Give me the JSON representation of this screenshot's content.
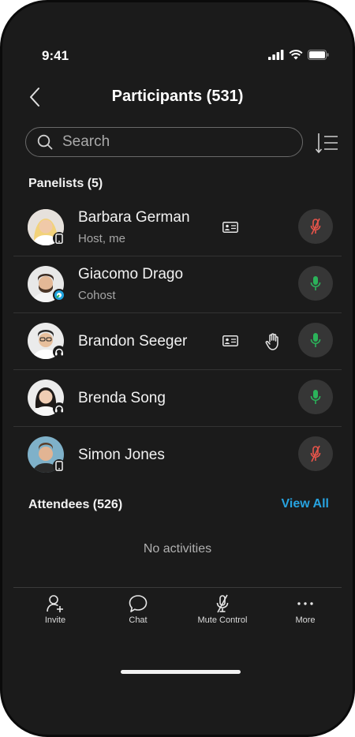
{
  "status": {
    "time": "9:41"
  },
  "header": {
    "title": "Participants (531)"
  },
  "search": {
    "placeholder": "Search"
  },
  "panelists": {
    "label": "Panelists (5)",
    "items": [
      {
        "name": "Barbara German",
        "role": "Host, me",
        "mic": "muted",
        "has_card": true,
        "hand_raised": false,
        "badge": "phone-icon"
      },
      {
        "name": "Giacomo Drago",
        "role": "Cohost",
        "mic": "on",
        "has_card": false,
        "hand_raised": false,
        "badge": "webex-app-icon"
      },
      {
        "name": "Brandon Seeger",
        "role": "",
        "mic": "on",
        "has_card": true,
        "hand_raised": true,
        "badge": "headset-icon"
      },
      {
        "name": "Brenda Song",
        "role": "",
        "mic": "on",
        "has_card": false,
        "hand_raised": false,
        "badge": "headset-icon"
      },
      {
        "name": "Simon Jones",
        "role": "",
        "mic": "muted",
        "has_card": false,
        "hand_raised": false,
        "badge": "phone-icon"
      }
    ]
  },
  "attendees": {
    "label": "Attendees (526)",
    "view_all": "View All",
    "empty": "No activities"
  },
  "tabbar": {
    "items": [
      {
        "label": "Invite",
        "icon": "add-person-icon"
      },
      {
        "label": "Chat",
        "icon": "chat-bubble-icon"
      },
      {
        "label": "Mute Control",
        "icon": "mic-off-icon"
      },
      {
        "label": "More",
        "icon": "more-dots-icon"
      }
    ]
  },
  "colors": {
    "background": "#1b1b1b",
    "accent": "#27a3e0",
    "mic_on": "#2bb35a",
    "mic_muted": "#e8544a"
  }
}
